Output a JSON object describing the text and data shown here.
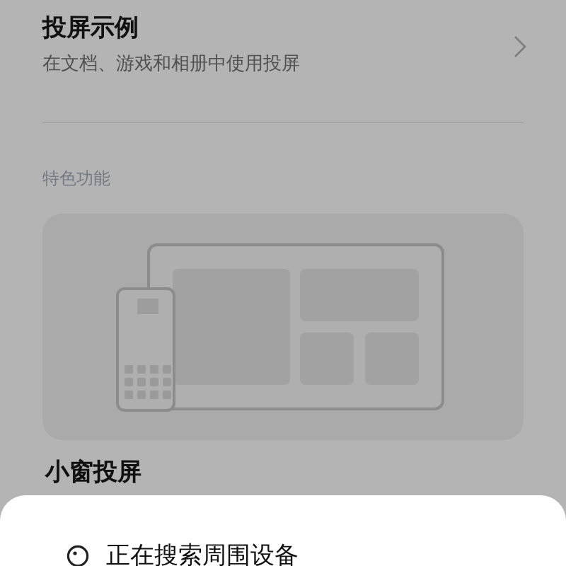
{
  "entry": {
    "title": "投屏示例",
    "subtitle": "在文档、游戏和相册中使用投屏"
  },
  "section_header": "特色功能",
  "feature": {
    "title": "小窗投屏"
  },
  "sheet": {
    "status": "正在搜索周围设备"
  }
}
